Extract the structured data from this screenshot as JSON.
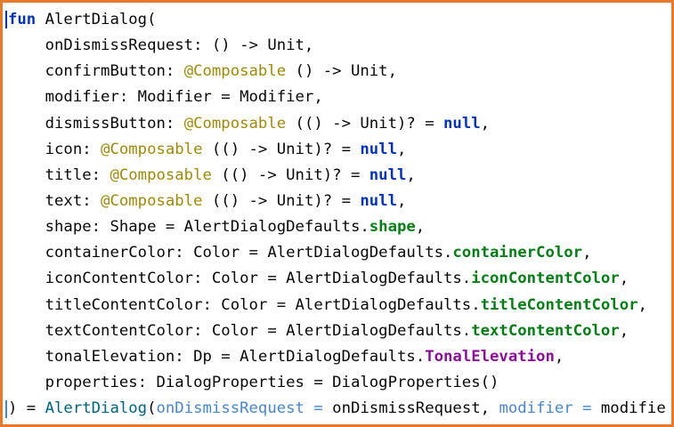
{
  "editor": {
    "lines": [
      [
        {
          "t": "fun",
          "c": "kw"
        },
        {
          "t": " AlertDialog(",
          "c": ""
        }
      ],
      [
        {
          "t": "    onDismissRequest: () -> Unit,",
          "c": ""
        }
      ],
      [
        {
          "t": "    confirmButton: ",
          "c": ""
        },
        {
          "t": "@Composable",
          "c": "ann"
        },
        {
          "t": " () -> Unit,",
          "c": ""
        }
      ],
      [
        {
          "t": "    modifier: Modifier = Modifier,",
          "c": ""
        }
      ],
      [
        {
          "t": "    dismissButton: ",
          "c": ""
        },
        {
          "t": "@Composable",
          "c": "ann"
        },
        {
          "t": " (() -> Unit)? = ",
          "c": ""
        },
        {
          "t": "null",
          "c": "kw"
        },
        {
          "t": ",",
          "c": ""
        }
      ],
      [
        {
          "t": "    icon: ",
          "c": ""
        },
        {
          "t": "@Composable",
          "c": "ann"
        },
        {
          "t": " (() -> Unit)? = ",
          "c": ""
        },
        {
          "t": "null",
          "c": "kw"
        },
        {
          "t": ",",
          "c": ""
        }
      ],
      [
        {
          "t": "    title: ",
          "c": ""
        },
        {
          "t": "@Composable",
          "c": "ann"
        },
        {
          "t": " (() -> Unit)? = ",
          "c": ""
        },
        {
          "t": "null",
          "c": "kw"
        },
        {
          "t": ",",
          "c": ""
        }
      ],
      [
        {
          "t": "    text: ",
          "c": ""
        },
        {
          "t": "@Composable",
          "c": "ann"
        },
        {
          "t": " (() -> Unit)? = ",
          "c": ""
        },
        {
          "t": "null",
          "c": "kw"
        },
        {
          "t": ",",
          "c": ""
        }
      ],
      [
        {
          "t": "    shape: Shape = AlertDialogDefaults.",
          "c": ""
        },
        {
          "t": "shape",
          "c": "prop"
        },
        {
          "t": ",",
          "c": ""
        }
      ],
      [
        {
          "t": "    containerColor: Color = AlertDialogDefaults.",
          "c": ""
        },
        {
          "t": "containerColor",
          "c": "prop"
        },
        {
          "t": ",",
          "c": ""
        }
      ],
      [
        {
          "t": "    iconContentColor: Color = AlertDialogDefaults.",
          "c": ""
        },
        {
          "t": "iconContentColor",
          "c": "prop"
        },
        {
          "t": ",",
          "c": ""
        }
      ],
      [
        {
          "t": "    titleContentColor: Color = AlertDialogDefaults.",
          "c": ""
        },
        {
          "t": "titleContentColor",
          "c": "prop"
        },
        {
          "t": ",",
          "c": ""
        }
      ],
      [
        {
          "t": "    textContentColor: Color = AlertDialogDefaults.",
          "c": ""
        },
        {
          "t": "textContentColor",
          "c": "prop"
        },
        {
          "t": ",",
          "c": ""
        }
      ],
      [
        {
          "t": "    tonalElevation: Dp = AlertDialogDefaults.",
          "c": ""
        },
        {
          "t": "TonalElevation",
          "c": "const"
        },
        {
          "t": ",",
          "c": ""
        }
      ],
      [
        {
          "t": "    properties: DialogProperties = DialogProperties()",
          "c": ""
        }
      ],
      [
        {
          "t": ") = ",
          "c": ""
        },
        {
          "t": "AlertDialog",
          "c": "fn"
        },
        {
          "t": "(",
          "c": ""
        },
        {
          "t": "onDismissRequest =",
          "c": "named"
        },
        {
          "t": " onDismissRequest, ",
          "c": ""
        },
        {
          "t": "modifier =",
          "c": "named"
        },
        {
          "t": " modifie",
          "c": ""
        }
      ]
    ]
  },
  "colors": {
    "border": "#e8782a",
    "background": "#ffffff",
    "keyword": "#0033b3",
    "annotation": "#9e880d",
    "property": "#067d17",
    "constant": "#871094",
    "function": "#00627a",
    "named_argument": "#4a86c8"
  }
}
